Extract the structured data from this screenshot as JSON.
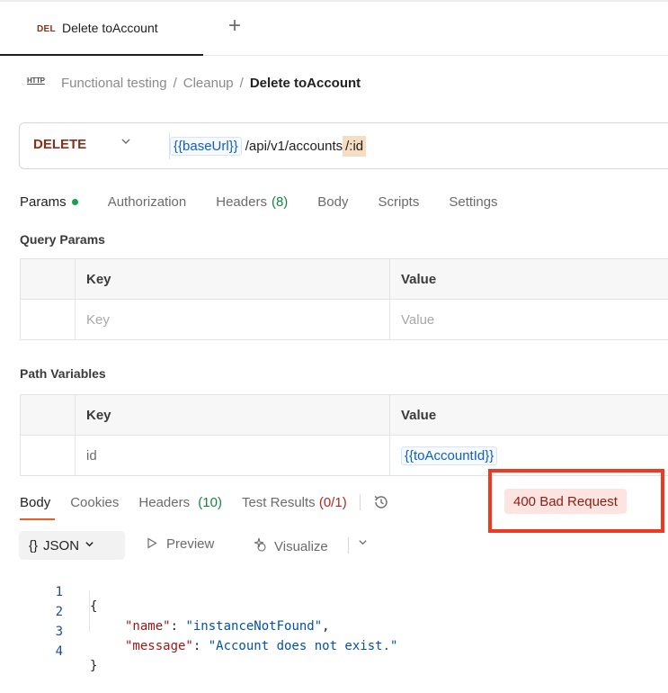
{
  "tab": {
    "method": "DEL",
    "title": "Delete toAccount",
    "new_tab": "+"
  },
  "breadcrumb": {
    "icon": "HTTP",
    "parts": [
      "Functional testing",
      "Cleanup"
    ],
    "current": "Delete toAccount",
    "sep": "/"
  },
  "request": {
    "method": "DELETE",
    "url_var": "{{baseUrl}}",
    "url_path": "/api/v1/accounts",
    "url_param": "/:id"
  },
  "request_tabs": {
    "params": "Params",
    "authorization": "Authorization",
    "headers": "Headers",
    "headers_count": "(8)",
    "body": "Body",
    "scripts": "Scripts",
    "settings": "Settings"
  },
  "query_params": {
    "label": "Query Params",
    "columns": [
      "Key",
      "Value"
    ],
    "placeholder": {
      "key": "Key",
      "value": "Value"
    }
  },
  "path_variables": {
    "label": "Path Variables",
    "columns": [
      "Key",
      "Value"
    ],
    "rows": [
      {
        "key": "id",
        "value": "{{toAccountId}}"
      }
    ]
  },
  "response_tabs": {
    "body": "Body",
    "cookies": "Cookies",
    "headers": "Headers",
    "headers_count": "(10)",
    "tests": "Test Results",
    "tests_count": "(0/1)"
  },
  "status": {
    "text": "400 Bad Request",
    "highlight_color": "#ef3a22"
  },
  "format": {
    "braces": "{}",
    "label": "JSON",
    "preview": "Preview",
    "visualize": "Visualize"
  },
  "code": {
    "lines": [
      {
        "n": "1",
        "open": "{"
      },
      {
        "n": "2",
        "key": "\"name\"",
        "value": "\"instanceNotFound\"",
        "tail": ","
      },
      {
        "n": "3",
        "key": "\"message\"",
        "value": "\"Account does not exist.\"",
        "tail": ""
      },
      {
        "n": "4",
        "close": "}"
      }
    ]
  },
  "colors": {
    "accent": "#ef5b25",
    "method": "#8a2f1a",
    "variable": "#0e5fbf",
    "success": "#12a150"
  }
}
